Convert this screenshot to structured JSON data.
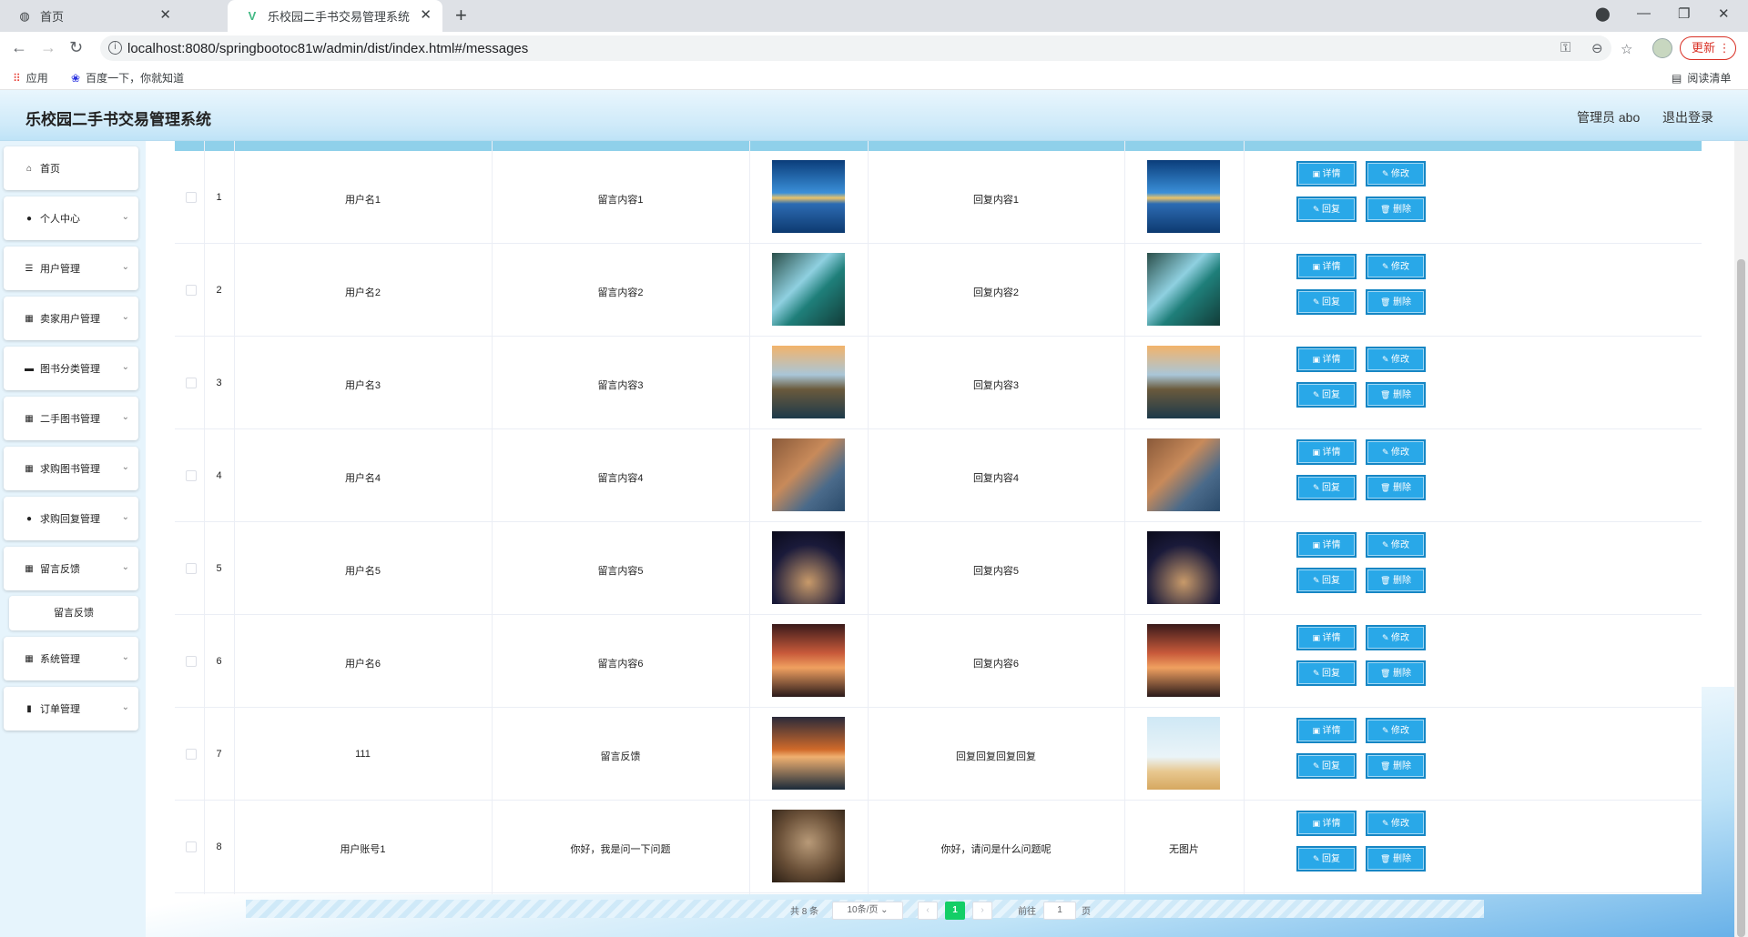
{
  "browser": {
    "tabs": [
      {
        "label": "首页",
        "icon": "globe-icon"
      },
      {
        "label": "乐校园二手书交易管理系统",
        "icon": "vue-logo-icon"
      }
    ],
    "url": "localhost:8080/springbootoc81w/admin/dist/index.html#/messages",
    "update_label": "更新",
    "bookmarks": [
      {
        "label": "应用",
        "icon": "apps-grid-icon"
      },
      {
        "label": "百度一下，你就知道",
        "icon": "baidu-paw-icon"
      }
    ],
    "reading_list": "阅读清单"
  },
  "header": {
    "title": "乐校园二手书交易管理系统",
    "admin": "管理员 abo",
    "logout": "退出登录"
  },
  "sidebar": {
    "items": [
      {
        "label": "首页",
        "icon": "home-icon",
        "expandable": false
      },
      {
        "label": "个人中心",
        "icon": "user-icon",
        "expandable": true
      },
      {
        "label": "用户管理",
        "icon": "sliders-icon",
        "expandable": true
      },
      {
        "label": "卖家用户管理",
        "icon": "grid-icon",
        "expandable": true
      },
      {
        "label": "图书分类管理",
        "icon": "briefcase-icon",
        "expandable": true
      },
      {
        "label": "二手图书管理",
        "icon": "grid-icon",
        "expandable": true
      },
      {
        "label": "求购图书管理",
        "icon": "grid-icon",
        "expandable": true
      },
      {
        "label": "求购回复管理",
        "icon": "user-icon",
        "expandable": true
      },
      {
        "label": "留言反馈",
        "icon": "grid-icon",
        "expandable": true
      },
      {
        "label": "系统管理",
        "icon": "grid-icon",
        "expandable": true
      },
      {
        "label": "订单管理",
        "icon": "bar-chart-icon",
        "expandable": true
      }
    ],
    "sub_item": "留言反馈"
  },
  "table": {
    "rows": [
      {
        "index": "1",
        "username": "用户名1",
        "content": "留言内容1",
        "reply": "回复内容1",
        "img": "lake-tree",
        "reply_img": "lake-tree"
      },
      {
        "index": "2",
        "username": "用户名2",
        "content": "留言内容2",
        "reply": "回复内容2",
        "img": "teal-lake",
        "reply_img": "teal-lake"
      },
      {
        "index": "3",
        "username": "用户名3",
        "content": "留言内容3",
        "reply": "回复内容3",
        "img": "island-sunset",
        "reply_img": "island-sunset"
      },
      {
        "index": "4",
        "username": "用户名4",
        "content": "留言内容4",
        "reply": "回复内容4",
        "img": "coastal-town",
        "reply_img": "coastal-town"
      },
      {
        "index": "5",
        "username": "用户名5",
        "content": "留言内容5",
        "reply": "回复内容5",
        "img": "night-jar",
        "reply_img": "night-jar"
      },
      {
        "index": "6",
        "username": "用户名6",
        "content": "留言内容6",
        "reply": "回复内容6",
        "img": "balloon-girl",
        "reply_img": "balloon-girl"
      },
      {
        "index": "7",
        "username": "111",
        "content": "留言反馈",
        "reply": "回复回复回复回复",
        "img": "sea-sunset",
        "reply_img": "cartoon-field"
      },
      {
        "index": "8",
        "username": "用户账号1",
        "content": "你好，我是问一下问题",
        "reply": "你好，请问是什么问题呢",
        "img": "cat",
        "reply_img": null,
        "reply_img_text": "无图片"
      }
    ],
    "actions": {
      "detail": "详情",
      "edit": "修改",
      "reply": "回复",
      "delete": "删除"
    }
  },
  "pagination": {
    "total": "共 8 条",
    "page_size": "10条/页",
    "current": "1",
    "goto_label": "前往",
    "goto_value": "1",
    "page_suffix": "页"
  },
  "colors": {
    "accent": "#29a8e8",
    "header_bg": "#cfeaf9",
    "page_active": "#13ce66"
  }
}
